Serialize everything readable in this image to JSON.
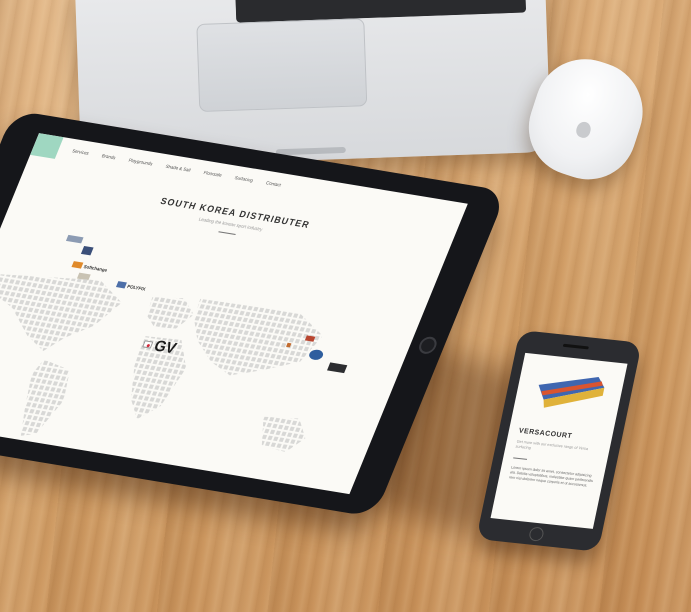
{
  "scene": "desk-mockup",
  "tablet": {
    "nav": [
      "Services",
      "Brands",
      "Playgrounds",
      "Shade & Sail",
      "Floorsafe",
      "Surfacing",
      "Contact"
    ],
    "title": "SOUTH KOREA DISTRIBUTER",
    "subtitle": "Leading the korean sport industry",
    "brands": {
      "left_1": "",
      "left_2": "",
      "left_3": "Softchange",
      "left_4": "",
      "polyfix": "POLYFIX",
      "right_1": "",
      "right_2": ""
    },
    "distributor_logo": "GV"
  },
  "phone": {
    "title": "VERSACOURT",
    "subtitle": "Get more with our exclusive range of Versa surfacing",
    "body": "Lorem ipsum dolor sit amet, consectetur adipisicing elit. Debitis voluptatibus, molestiae quam perferendis rem nisi dolorem neque corporis et ut accusamus."
  },
  "colors": {
    "wood": "#d9a873",
    "nav_accent": "#9fd7c1",
    "tablet_bezel": "#15161a",
    "flag_red": "#d12a3b"
  }
}
